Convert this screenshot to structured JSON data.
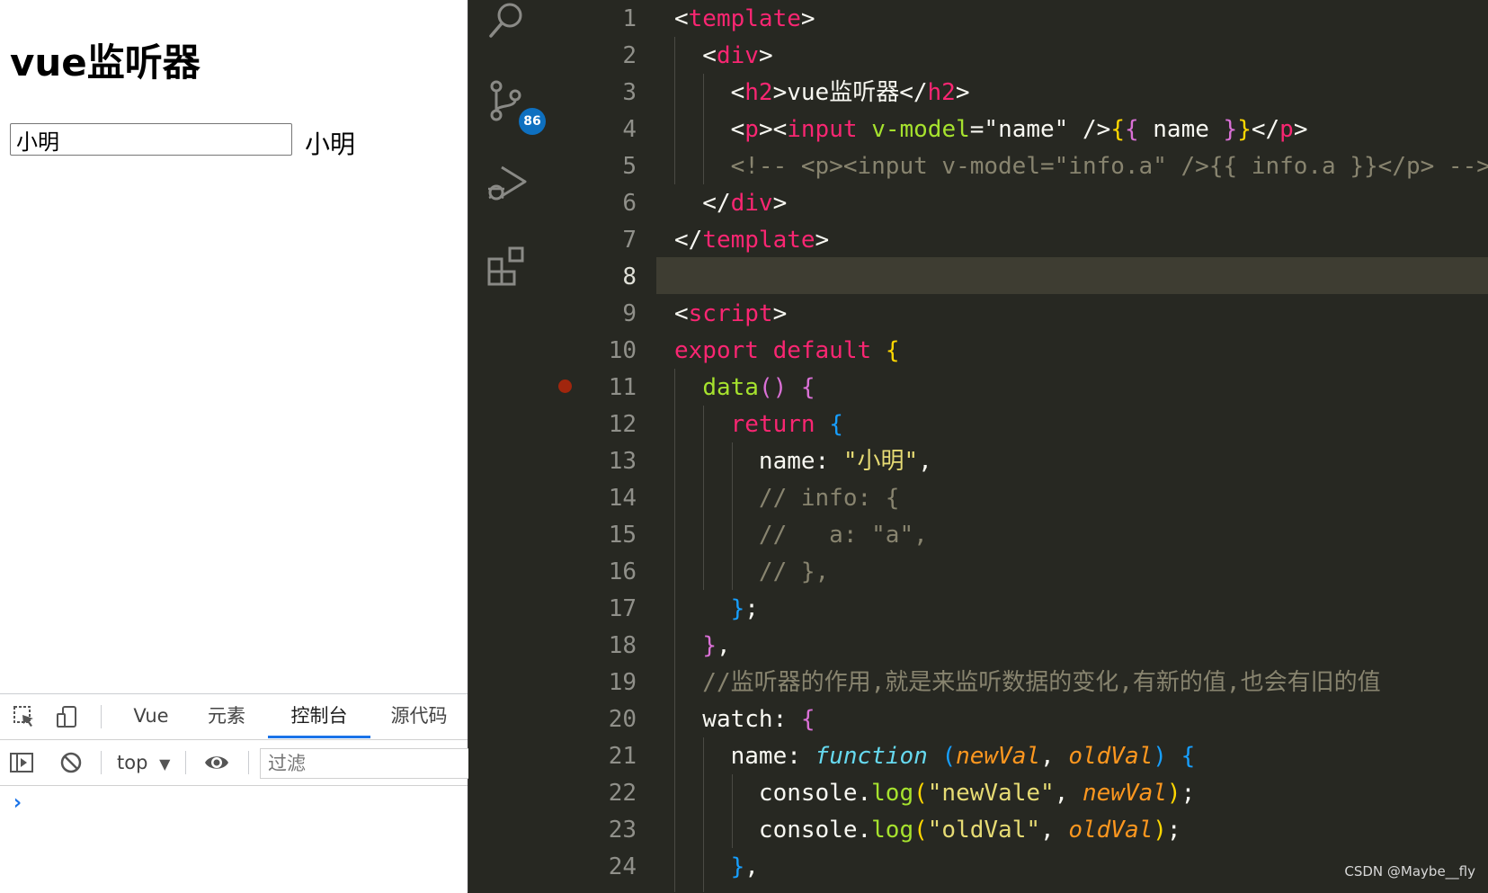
{
  "preview": {
    "heading": "vue监听器",
    "input_value": "小明",
    "echo_text": "小明"
  },
  "devtools": {
    "tabs": [
      {
        "label": "Vue",
        "active": false
      },
      {
        "label": "元素",
        "active": false
      },
      {
        "label": "控制台",
        "active": true
      },
      {
        "label": "源代码",
        "active": false
      }
    ],
    "context": "top",
    "filter_placeholder": "过滤",
    "prompt": "›",
    "icons": [
      "inspect-element-icon",
      "device-toolbar-icon",
      "sidebar-toggle-icon",
      "clear-console-icon",
      "live-expression-eye-icon"
    ]
  },
  "activity_bar": {
    "icons": [
      "search-icon",
      "source-control-icon",
      "run-debug-icon",
      "extensions-icon"
    ],
    "scm_badge": "86"
  },
  "editor": {
    "current_line": 8,
    "breakpoint_line": 11,
    "line_numbers": [
      "1",
      "2",
      "3",
      "4",
      "5",
      "6",
      "7",
      "8",
      "9",
      "10",
      "11",
      "12",
      "13",
      "14",
      "15",
      "16",
      "17",
      "18",
      "19",
      "20",
      "21",
      "22",
      "23",
      "24"
    ],
    "lines": [
      [
        [
          "t-p",
          "<"
        ],
        [
          "t-tag",
          "template"
        ],
        [
          "t-p",
          ">"
        ]
      ],
      [
        [
          "t-p",
          "  <"
        ],
        [
          "t-tag",
          "div"
        ],
        [
          "t-p",
          ">"
        ]
      ],
      [
        [
          "t-p",
          "    <"
        ],
        [
          "t-tag",
          "h2"
        ],
        [
          "t-p",
          ">vue监听器</"
        ],
        [
          "t-tag",
          "h2"
        ],
        [
          "t-p",
          ">"
        ]
      ],
      [
        [
          "t-p",
          "    <"
        ],
        [
          "t-tag",
          "p"
        ],
        [
          "t-p",
          "><"
        ],
        [
          "t-tag",
          "input"
        ],
        [
          "t-p",
          " "
        ],
        [
          "t-attr",
          "v-model"
        ],
        [
          "t-p",
          "=\"name\" />"
        ],
        [
          "t-b1",
          "{"
        ],
        [
          "t-b2",
          "{"
        ],
        [
          "t-p",
          " name "
        ],
        [
          "t-b2",
          "}"
        ],
        [
          "t-b1",
          "}"
        ],
        [
          "t-p",
          "</"
        ],
        [
          "t-tag",
          "p"
        ],
        [
          "t-p",
          ">"
        ]
      ],
      [
        [
          "t-cm",
          "    <!-- <p><input v-model=\"info.a\" />{{ info.a }}</p> -->"
        ]
      ],
      [
        [
          "t-p",
          "  </"
        ],
        [
          "t-tag",
          "div"
        ],
        [
          "t-p",
          ">"
        ]
      ],
      [
        [
          "t-p",
          "</"
        ],
        [
          "t-tag",
          "template"
        ],
        [
          "t-p",
          ">"
        ]
      ],
      [
        [
          "t-p",
          ""
        ]
      ],
      [
        [
          "t-p",
          "<"
        ],
        [
          "t-tag",
          "script"
        ],
        [
          "t-p",
          ">"
        ]
      ],
      [
        [
          "t-kw",
          "export default "
        ],
        [
          "t-b1",
          "{"
        ]
      ],
      [
        [
          "t-p",
          "  "
        ],
        [
          "t-fn",
          "data"
        ],
        [
          "t-b2",
          "()"
        ],
        [
          "t-p",
          " "
        ],
        [
          "t-b2",
          "{"
        ]
      ],
      [
        [
          "t-p",
          "    "
        ],
        [
          "t-kw",
          "return "
        ],
        [
          "t-b3",
          "{"
        ]
      ],
      [
        [
          "t-p",
          "      name: "
        ],
        [
          "t-str",
          "\"小明\""
        ],
        [
          "t-p",
          ","
        ]
      ],
      [
        [
          "t-cm",
          "      // info: {"
        ]
      ],
      [
        [
          "t-cm",
          "      //   a: \"a\","
        ]
      ],
      [
        [
          "t-cm",
          "      // },"
        ]
      ],
      [
        [
          "t-p",
          "    "
        ],
        [
          "t-b3",
          "}"
        ],
        [
          "t-p",
          ";"
        ]
      ],
      [
        [
          "t-p",
          "  "
        ],
        [
          "t-b2",
          "}"
        ],
        [
          "t-p",
          ","
        ]
      ],
      [
        [
          "t-cm",
          "  //监听器的作用,就是来监听数据的变化,有新的值,也会有旧的值"
        ]
      ],
      [
        [
          "t-p",
          "  watch: "
        ],
        [
          "t-b2",
          "{"
        ]
      ],
      [
        [
          "t-p",
          "    name: "
        ],
        [
          "t-type",
          "function"
        ],
        [
          "t-p",
          " "
        ],
        [
          "t-b3",
          "("
        ],
        [
          "t-param",
          "newVal"
        ],
        [
          "t-p",
          ", "
        ],
        [
          "t-param",
          "oldVal"
        ],
        [
          "t-b3",
          ")"
        ],
        [
          "t-p",
          " "
        ],
        [
          "t-b3",
          "{"
        ]
      ],
      [
        [
          "t-p",
          "      console."
        ],
        [
          "t-fn",
          "log"
        ],
        [
          "t-b1",
          "("
        ],
        [
          "t-str",
          "\"newVale\""
        ],
        [
          "t-p",
          ", "
        ],
        [
          "t-param",
          "newVal"
        ],
        [
          "t-b1",
          ")"
        ],
        [
          "t-p",
          ";"
        ]
      ],
      [
        [
          "t-p",
          "      console."
        ],
        [
          "t-fn",
          "log"
        ],
        [
          "t-b1",
          "("
        ],
        [
          "t-str",
          "\"oldVal\""
        ],
        [
          "t-p",
          ", "
        ],
        [
          "t-param",
          "oldVal"
        ],
        [
          "t-b1",
          ")"
        ],
        [
          "t-p",
          ";"
        ]
      ],
      [
        [
          "t-p",
          "    "
        ],
        [
          "t-b3",
          "}"
        ],
        [
          "t-p",
          ","
        ]
      ]
    ]
  },
  "watermark": "CSDN @Maybe__fly"
}
